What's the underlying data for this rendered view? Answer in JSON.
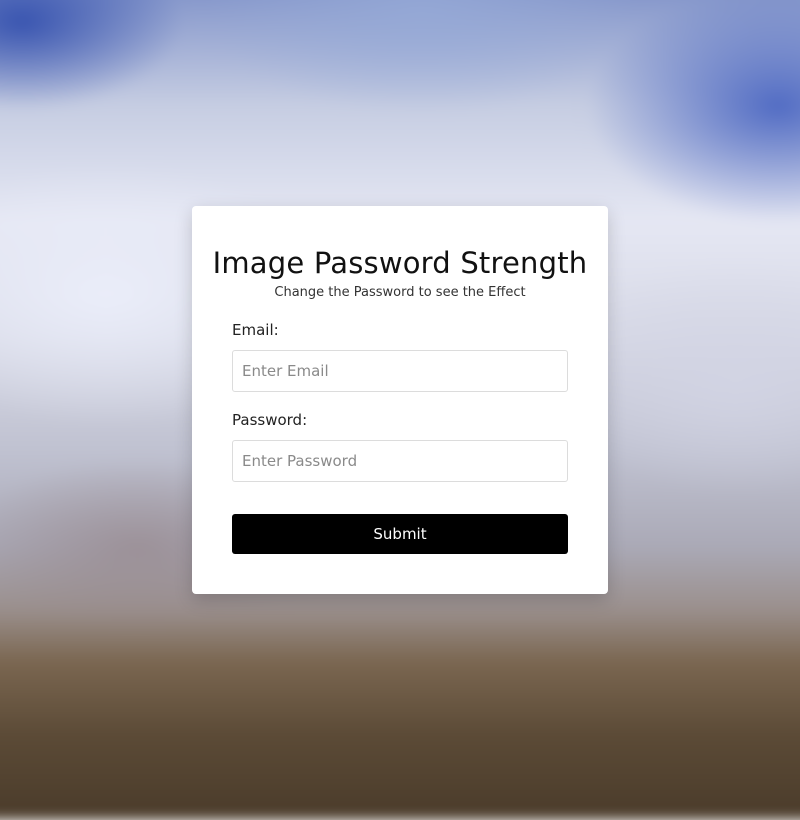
{
  "form": {
    "title": "Image Password Strength",
    "subtitle": "Change the Password to see the Effect",
    "email": {
      "label": "Email:",
      "value": "",
      "placeholder": "Enter Email"
    },
    "password": {
      "label": "Password:",
      "value": "",
      "placeholder": "Enter Password"
    },
    "submit_label": "Submit"
  },
  "colors": {
    "card_background": "#ffffff",
    "button_background": "#000000",
    "button_text": "#ffffff",
    "input_border": "#dcdcdc"
  }
}
